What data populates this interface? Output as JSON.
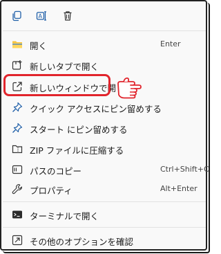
{
  "menu": {
    "toolbar": [
      {
        "icon": "copy-icon"
      },
      {
        "icon": "rename-icon"
      },
      {
        "icon": "delete-icon"
      }
    ],
    "items": [
      {
        "label": "開く",
        "key": "Enter",
        "icon": "folder-icon"
      },
      {
        "label": "新しいタブで開く",
        "key": "",
        "icon": "new-tab-icon"
      },
      {
        "label": "新しいウィンドウで開く",
        "key": "",
        "icon": "new-window-icon"
      },
      {
        "label": "クイック アクセスにピン留めする",
        "key": "",
        "icon": "pin-icon"
      },
      {
        "label": "スタート にピン留めする",
        "key": "",
        "icon": "pin-start-icon"
      },
      {
        "label": "ZIP ファイルに圧縮する",
        "key": "",
        "icon": "zip-icon"
      },
      {
        "label": "パスのコピー",
        "key": "Ctrl+Shift+C",
        "icon": "copy-path-icon"
      },
      {
        "label": "プロパティ",
        "key": "Alt+Enter",
        "icon": "properties-icon"
      },
      {
        "label": "ターミナルで開く",
        "key": "",
        "icon": "terminal-icon"
      },
      {
        "label": "その他のオプションを確認",
        "key": "",
        "icon": "more-options-icon"
      }
    ]
  },
  "colors": {
    "accent": "#0067c0",
    "highlight": "#e1242c",
    "folder": "#f5c23b"
  }
}
